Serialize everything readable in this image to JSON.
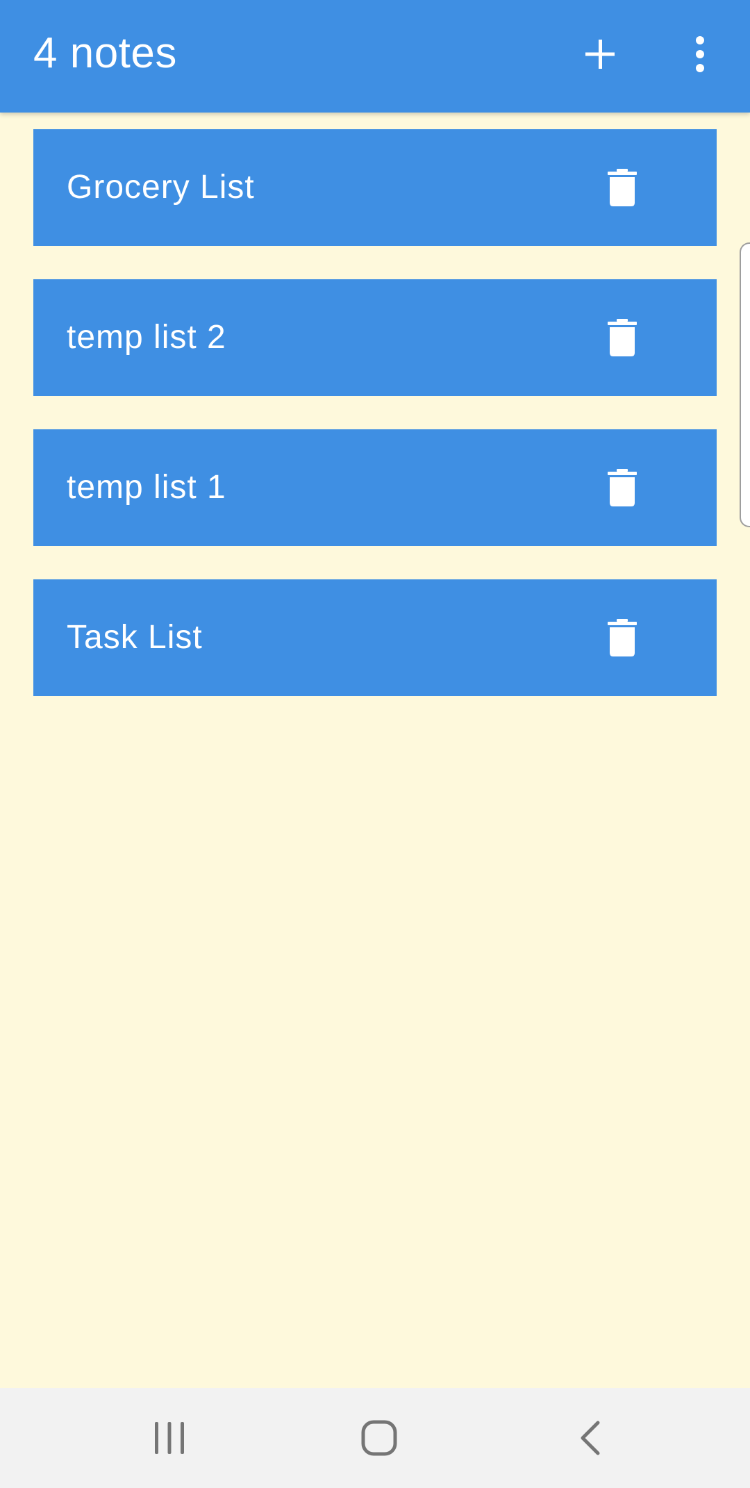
{
  "app_bar": {
    "title": "4 notes",
    "add_icon": "plus-icon",
    "menu_icon": "more-vert-icon",
    "background_color": "#3F8FE3"
  },
  "notes": [
    {
      "title": "Grocery List",
      "delete_icon": "trash-icon"
    },
    {
      "title": "temp list 2",
      "delete_icon": "trash-icon"
    },
    {
      "title": "temp list 1",
      "delete_icon": "trash-icon"
    },
    {
      "title": "Task List",
      "delete_icon": "trash-icon"
    }
  ],
  "colors": {
    "accent": "#3F8FE3",
    "background": "#FEF9DC",
    "text_on_accent": "#FFFFFF",
    "nav_bar": "#F2F2F2"
  },
  "nav_bar": {
    "recents_icon": "recents-icon",
    "home_icon": "home-icon",
    "back_icon": "back-icon"
  }
}
